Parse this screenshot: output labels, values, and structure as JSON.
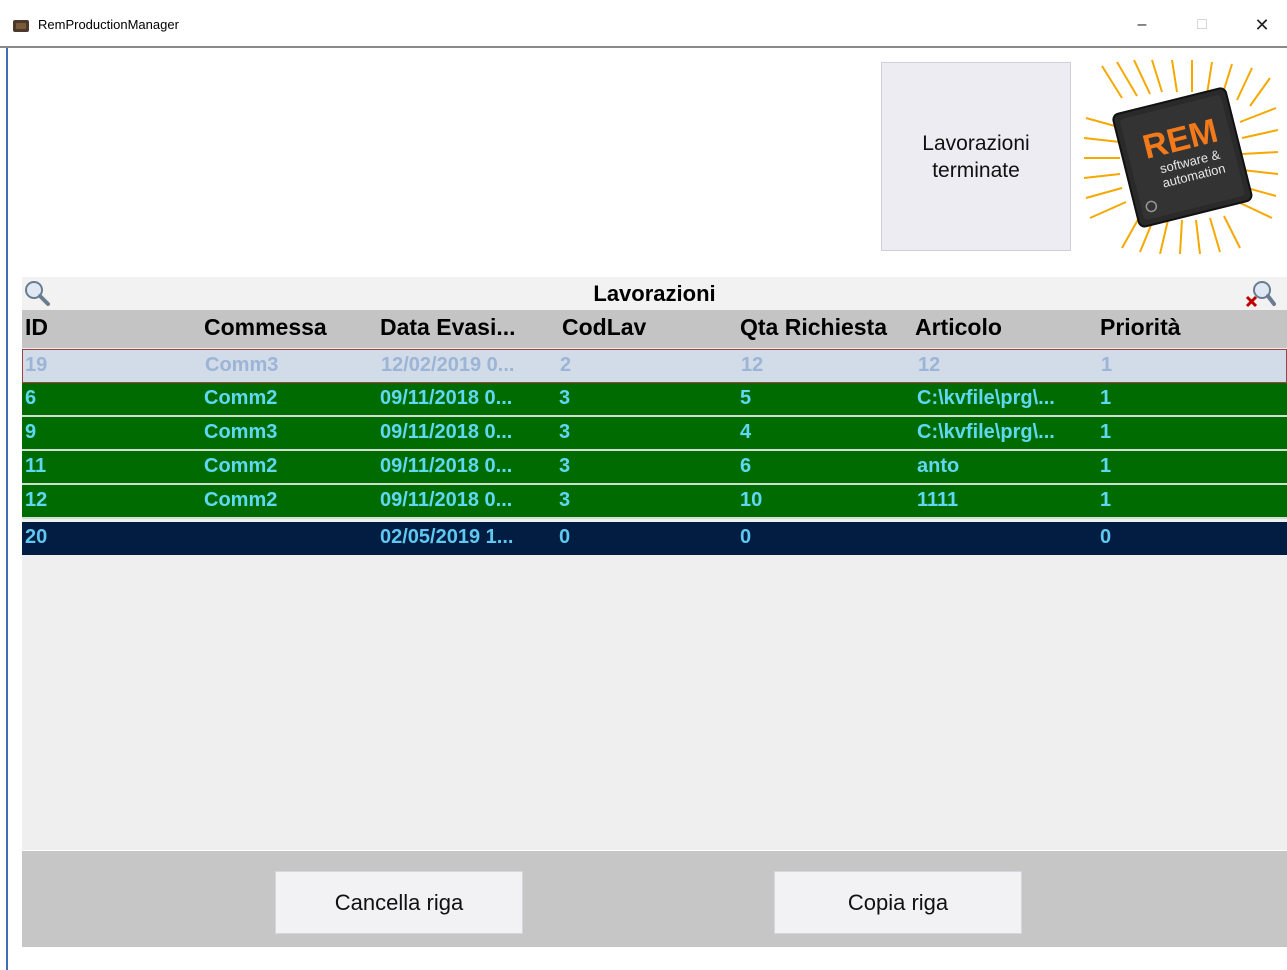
{
  "window": {
    "title": "RemProductionManager",
    "minimize_glyph": "–",
    "maximize_glyph": "□",
    "close_glyph": "✕"
  },
  "toolbar": {
    "finished_button_label": "Lavorazioni\nterminate"
  },
  "logo": {
    "brand": "REM",
    "tagline_1": "software &",
    "tagline_2": "automation"
  },
  "grid": {
    "title": "Lavorazioni",
    "columns": [
      "ID",
      "Commessa",
      "Data Evasi...",
      "CodLav",
      "Qta Richiesta",
      "Articolo",
      "Priorità"
    ],
    "rows": [
      {
        "state": "selected",
        "cells": [
          "19",
          "Comm3",
          "12/02/2019 0...",
          "2",
          "12",
          "12",
          "1"
        ]
      },
      {
        "state": "green",
        "cells": [
          "6",
          "Comm2",
          "09/11/2018 0...",
          "3",
          "5",
          "C:\\kvfile\\prg\\...",
          "1"
        ]
      },
      {
        "state": "green",
        "cells": [
          "9",
          "Comm3",
          "09/11/2018 0...",
          "3",
          "4",
          "C:\\kvfile\\prg\\...",
          "1"
        ]
      },
      {
        "state": "green",
        "cells": [
          "11",
          "Comm2",
          "09/11/2018 0...",
          "3",
          "6",
          "anto",
          "1"
        ]
      },
      {
        "state": "green",
        "cells": [
          "12",
          "Comm2",
          "09/11/2018 0...",
          "3",
          "10",
          "1111",
          "1"
        ]
      },
      {
        "state": "new",
        "cells": [
          "20",
          "",
          "02/05/2019 1...",
          "0",
          "0",
          "",
          "0"
        ]
      }
    ]
  },
  "actions": {
    "delete_label": "Cancella riga",
    "copy_label": "Copia riga"
  },
  "colors": {
    "row_green": "#006b00",
    "row_new": "#021c42",
    "row_selected": "#d1dce8",
    "cell_text_cyan": "#5fd8f4"
  },
  "icons": {
    "search": "search-icon",
    "clear_filter": "clear-filter-icon",
    "app": "app-icon"
  }
}
